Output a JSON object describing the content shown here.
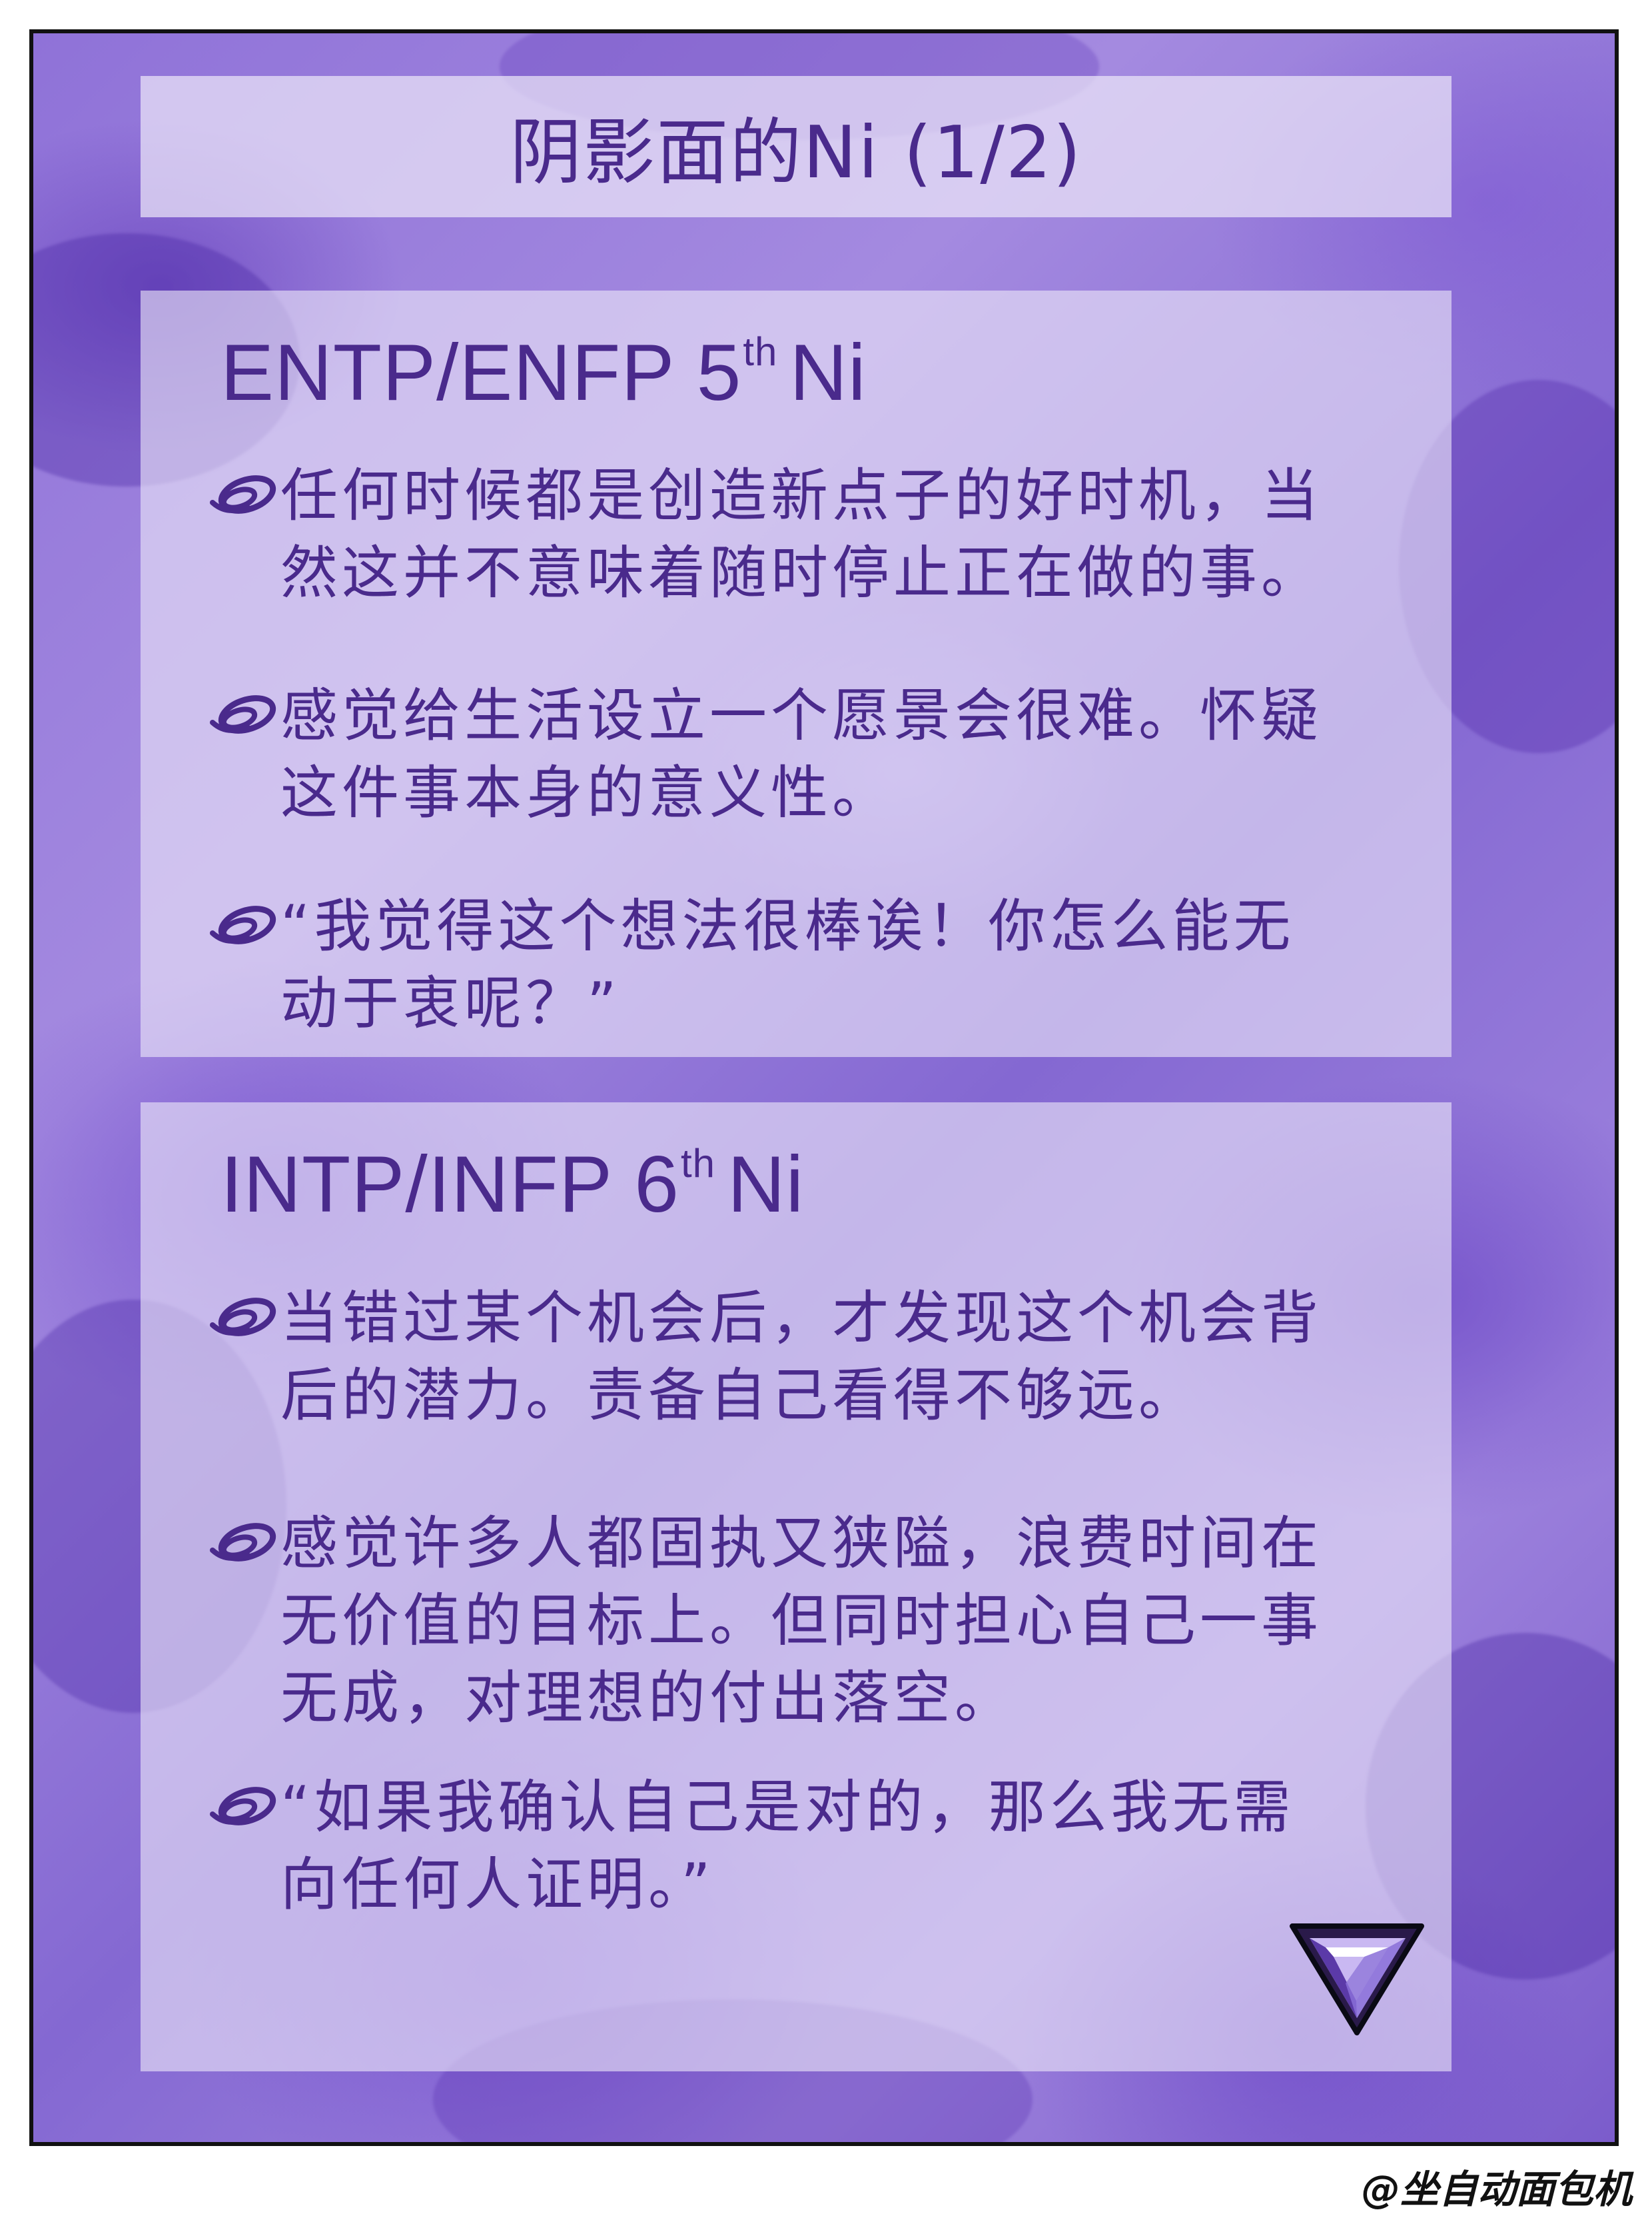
{
  "title": "阴影面的Ni (1/2)",
  "sections": [
    {
      "heading_main": "ENTP/ENFP 5",
      "heading_sup": "th",
      "heading_tail": "Ni",
      "items": [
        "任何时候都是创造新点子的好时机，当\n然这并不意味着随时停止正在做的事。",
        "感觉给生活设立一个愿景会很难。怀疑\n这件事本身的意义性。",
        "“我觉得这个想法很棒诶！你怎么能无\n动于衷呢？”"
      ]
    },
    {
      "heading_main": "INTP/INFP 6",
      "heading_sup": "th",
      "heading_tail": "Ni",
      "items": [
        "当错过某个机会后，才发现这个机会背\n后的潜力。责备自己看得不够远。",
        "感觉许多人都固执又狭隘，浪费时间在\n无价值的目标上。但同时担心自己一事\n无成，对理想的付出落空。",
        "“如果我确认自己是对的，那么我无需\n向任何人证明。”"
      ]
    }
  ],
  "credit": "@坐自动面包机",
  "colors": {
    "text": "#4a2a8c",
    "panel": "#ece6f8",
    "background": "#8f72d8",
    "border": "#111111"
  },
  "icons": {
    "bullet": "purple-loop-icon",
    "logo": "triangle-7-logo-icon"
  }
}
